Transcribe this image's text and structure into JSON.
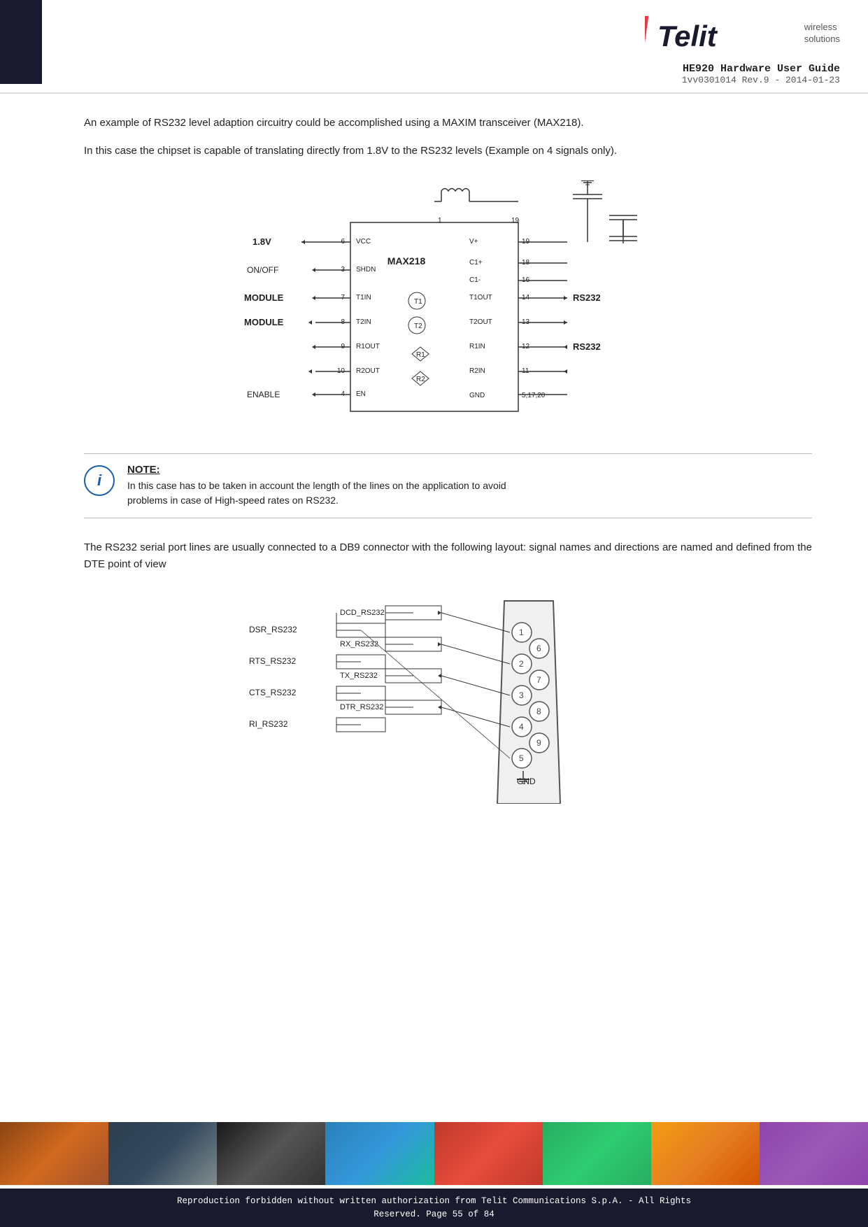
{
  "header": {
    "logo_text": "Telit",
    "logo_tagline_line1": "wireless",
    "logo_tagline_line2": "solutions",
    "doc_title": "HE920 Hardware User Guide",
    "doc_subtitle": "1vv0301014 Rev.9 - 2014-01-23"
  },
  "content": {
    "para1": "An example of RS232 level adaption circuitry could be accomplished using a MAXIM transceiver (MAX218).",
    "para2": "In this case the chipset is capable of translating directly from 1.8V to the RS232 levels (Example on 4 signals only).",
    "para3": "The RS232 serial port lines are usually connected to a DB9 connector with the following layout: signal names and directions are named and defined from the DTE point of view"
  },
  "note": {
    "title": "NOTE:",
    "text_line1": "In this case has to be taken in account the length of the lines on the application to avoid",
    "text_line2": "problems in case of High-speed rates on RS232."
  },
  "footer": {
    "text_line1": "Reproduction forbidden without written authorization from Telit Communications S.p.A. - All Rights",
    "text_line2": "Reserved.          Page 55 of 84"
  }
}
